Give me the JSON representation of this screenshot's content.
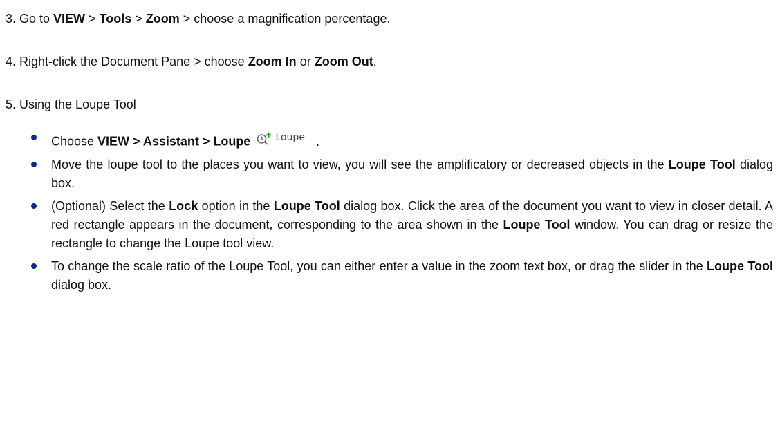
{
  "step3": {
    "pre": "3. Go to ",
    "b1": "VIEW",
    "s1": " > ",
    "b2": "Tools",
    "s2": " > ",
    "b3": "Zoom",
    "post": " > choose a magnification percentage."
  },
  "step4": {
    "pre": "4. Right-click the Document Pane > choose ",
    "b1": "Zoom In",
    "mid": " or ",
    "b2": "Zoom Out",
    "post": "."
  },
  "step5": {
    "text": "5. Using the Loupe Tool"
  },
  "bullets": [
    {
      "pre": "Choose ",
      "bold": "VIEW > Assistant > Loupe",
      "icon": "loupe-tool-icon",
      "icon_label": "Loupe",
      "post": "."
    },
    {
      "pre": "Move the loupe tool to the places you want to view, you will see the amplificatory or decreased objects in the ",
      "bold": "Loupe Tool",
      "post": " dialog box."
    },
    {
      "pre": "(Optional) Select the ",
      "b1": "Lock",
      "mid1": " option in the ",
      "b2": "Loupe Tool",
      "mid2": " dialog box. Click the area of the document you want to view in closer detail. A red rectangle appears in the document, corresponding to the area shown in the ",
      "b3": "Loupe Tool",
      "post": " window. You can drag or resize the rectangle to change the Loupe tool view."
    },
    {
      "pre": "To change the scale ratio of the Loupe Tool, you can either enter a value in the zoom text box, or drag the slider in the ",
      "bold": "Loupe Tool",
      "post": " dialog box."
    }
  ],
  "colors": {
    "text": "#111111",
    "bullet": "#0b2a8a",
    "icon_green": "#2aa52a"
  }
}
